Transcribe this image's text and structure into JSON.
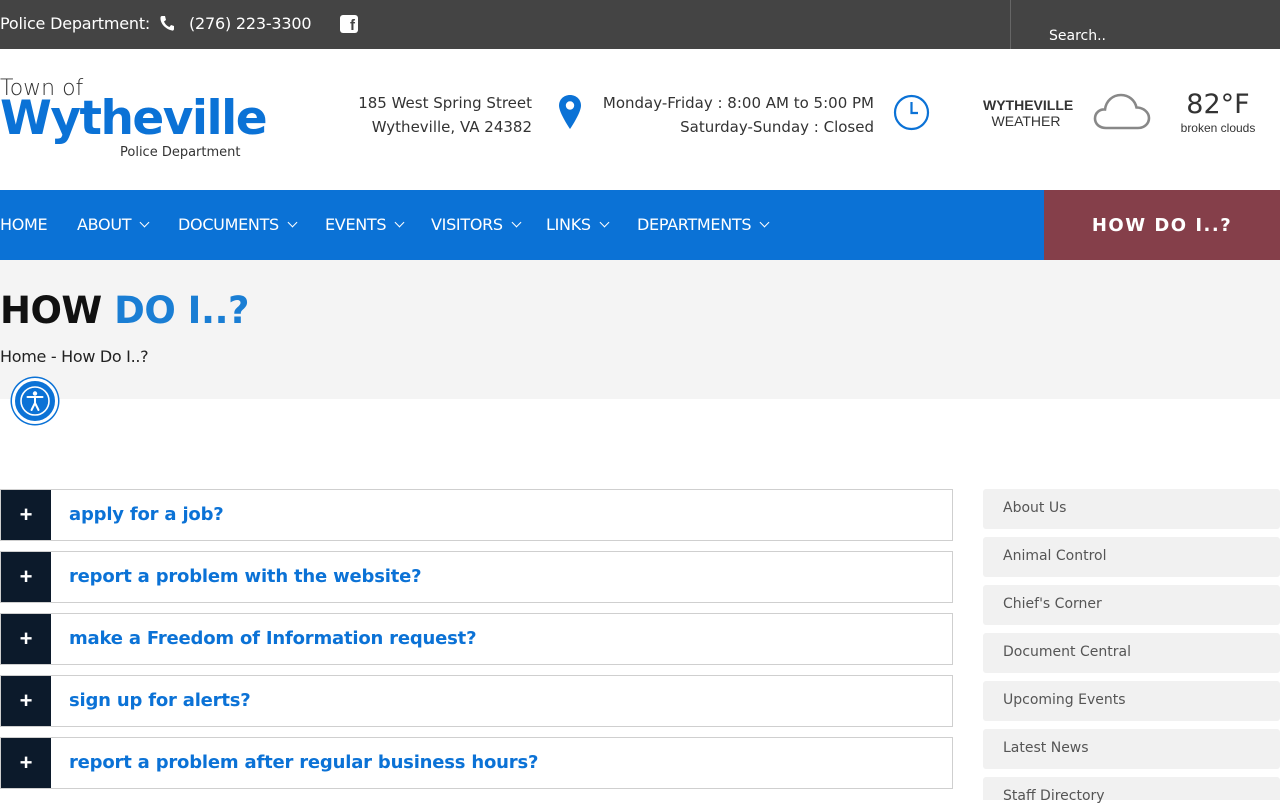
{
  "topbar": {
    "dept_label": "Police Department:",
    "phone": "(276) 223-3300",
    "search_placeholder": "Search.."
  },
  "header": {
    "logo": {
      "town": "Town of",
      "name": "Wytheville",
      "sub": "Police Department"
    },
    "address": {
      "line1": "185 West Spring Street",
      "line2": "Wytheville, VA 24382"
    },
    "hours": {
      "line1": "Monday-Friday : 8:00 AM to 5:00 PM",
      "line2": "Saturday-Sunday : Closed"
    },
    "weather": {
      "city": "WYTHEVILLE",
      "label": "WEATHER",
      "temp": "82°F",
      "condition": "broken clouds"
    }
  },
  "nav": {
    "items": [
      {
        "label": "HOME"
      },
      {
        "label": "ABOUT"
      },
      {
        "label": "DOCUMENTS"
      },
      {
        "label": "EVENTS"
      },
      {
        "label": "VISITORS"
      },
      {
        "label": "LINKS"
      },
      {
        "label": "DEPARTMENTS"
      }
    ],
    "howdo": "HOW DO I..?"
  },
  "page": {
    "title_main": "HOW",
    "title_accent": "DO I..?",
    "breadcrumb": "Home - How Do I..?"
  },
  "accordion": [
    {
      "icon": "+",
      "question": "apply for a job?"
    },
    {
      "icon": "+",
      "question": "report a problem with the website?"
    },
    {
      "icon": "+",
      "question": "make a Freedom of Information request?"
    },
    {
      "icon": "+",
      "question": "sign up for alerts?"
    },
    {
      "icon": "+",
      "question": "report a problem after regular business hours?"
    }
  ],
  "sidebar": [
    {
      "label": "About Us"
    },
    {
      "label": "Animal Control"
    },
    {
      "label": "Chief's Corner"
    },
    {
      "label": "Document Central"
    },
    {
      "label": "Upcoming Events"
    },
    {
      "label": "Latest News"
    },
    {
      "label": "Staff Directory"
    }
  ],
  "colors": {
    "brand": "#0b72d6",
    "topbar": "#444444",
    "howdo": "#853f4a",
    "accordion_icon_bg": "#0c1a2b"
  }
}
